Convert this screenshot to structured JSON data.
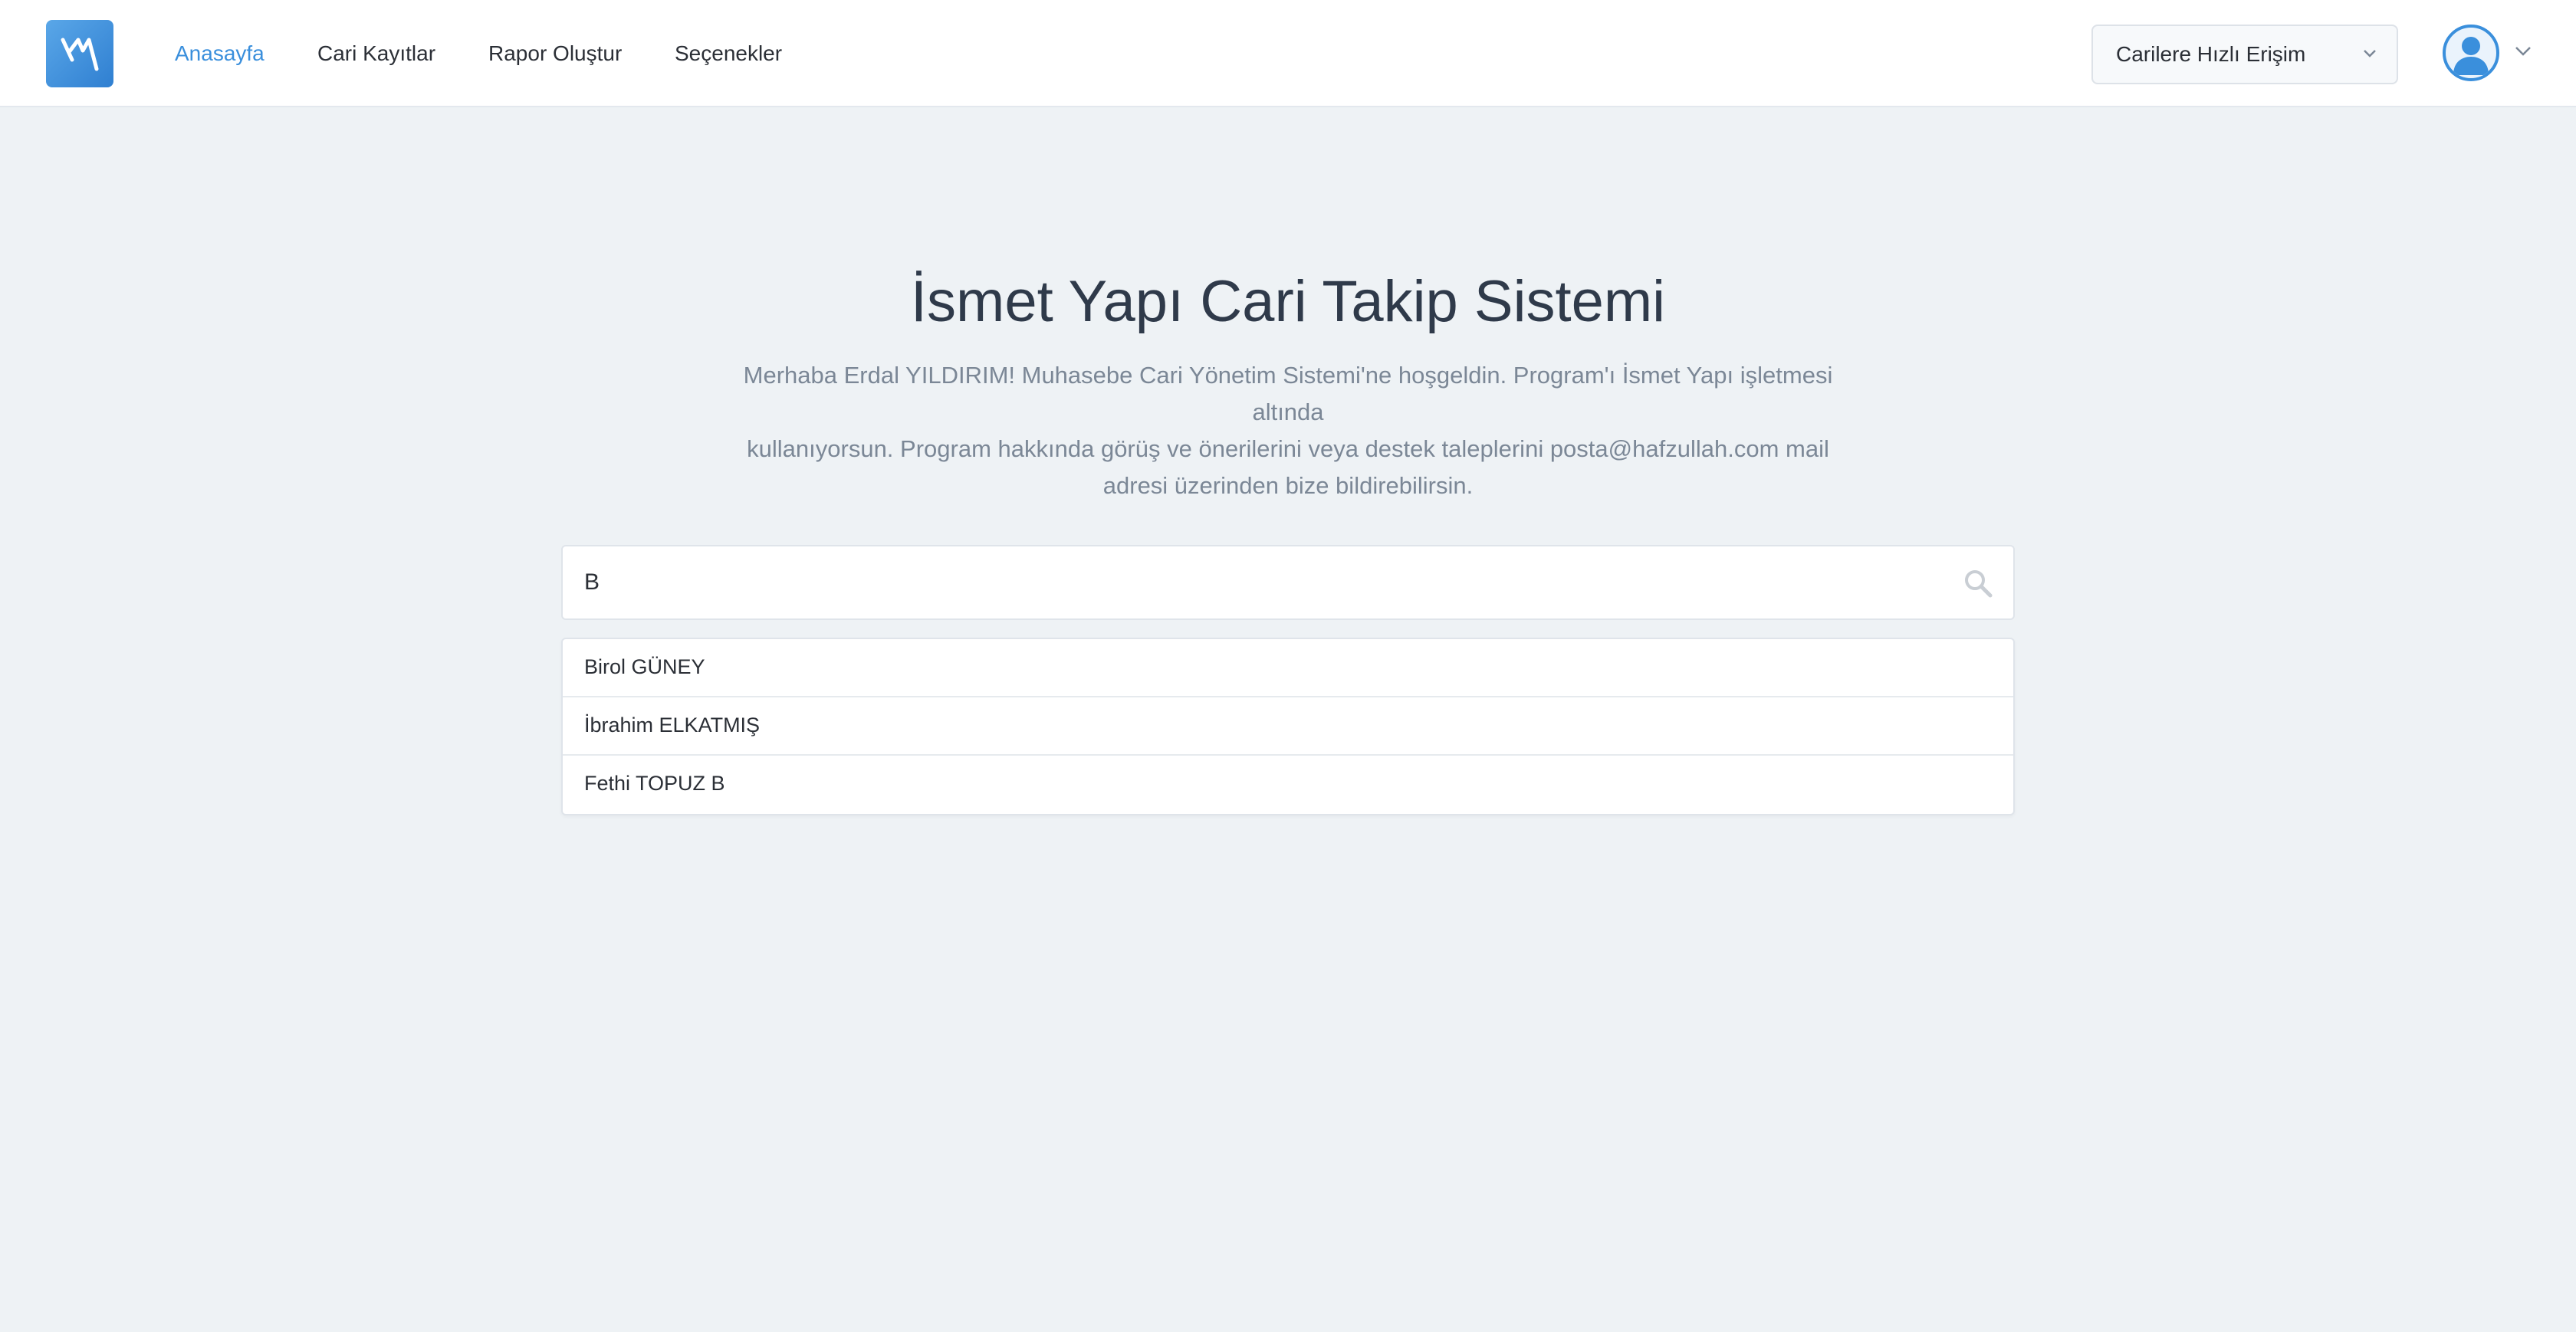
{
  "nav": {
    "links": [
      "Anasayfa",
      "Cari Kayıtlar",
      "Rapor Oluştur",
      "Seçenekler"
    ],
    "active_link": "Anasayfa",
    "active_color": "#3a8fdc"
  },
  "quick_access": {
    "selected": "Carilere Hızlı Erişim"
  },
  "hero": {
    "title": "İsmet Yapı Cari Takip Sistemi",
    "lines": [
      "Merhaba Erdal YILDIRIM! Muhasebe Cari Yönetim Sistemi'ne hoşgeldin. Program'ı İsmet Yapı işletmesi altında",
      "kullanıyorsun. Program hakkında görüş ve önerilerini veya destek taleplerini posta@hafzullah.com mail",
      "adresi üzerinden bize bildirebilirsin."
    ]
  },
  "search": {
    "value": "B"
  },
  "results": [
    "Birol GÜNEY",
    "İbrahim ELKATMIŞ",
    "Fethi TOPUZ B"
  ],
  "icons": {
    "logo": "app-logo",
    "search": "search-icon",
    "select_chevron": "chevron-down-icon",
    "avatar": "user-avatar-icon",
    "avatar_chevron": "chevron-down-icon"
  }
}
